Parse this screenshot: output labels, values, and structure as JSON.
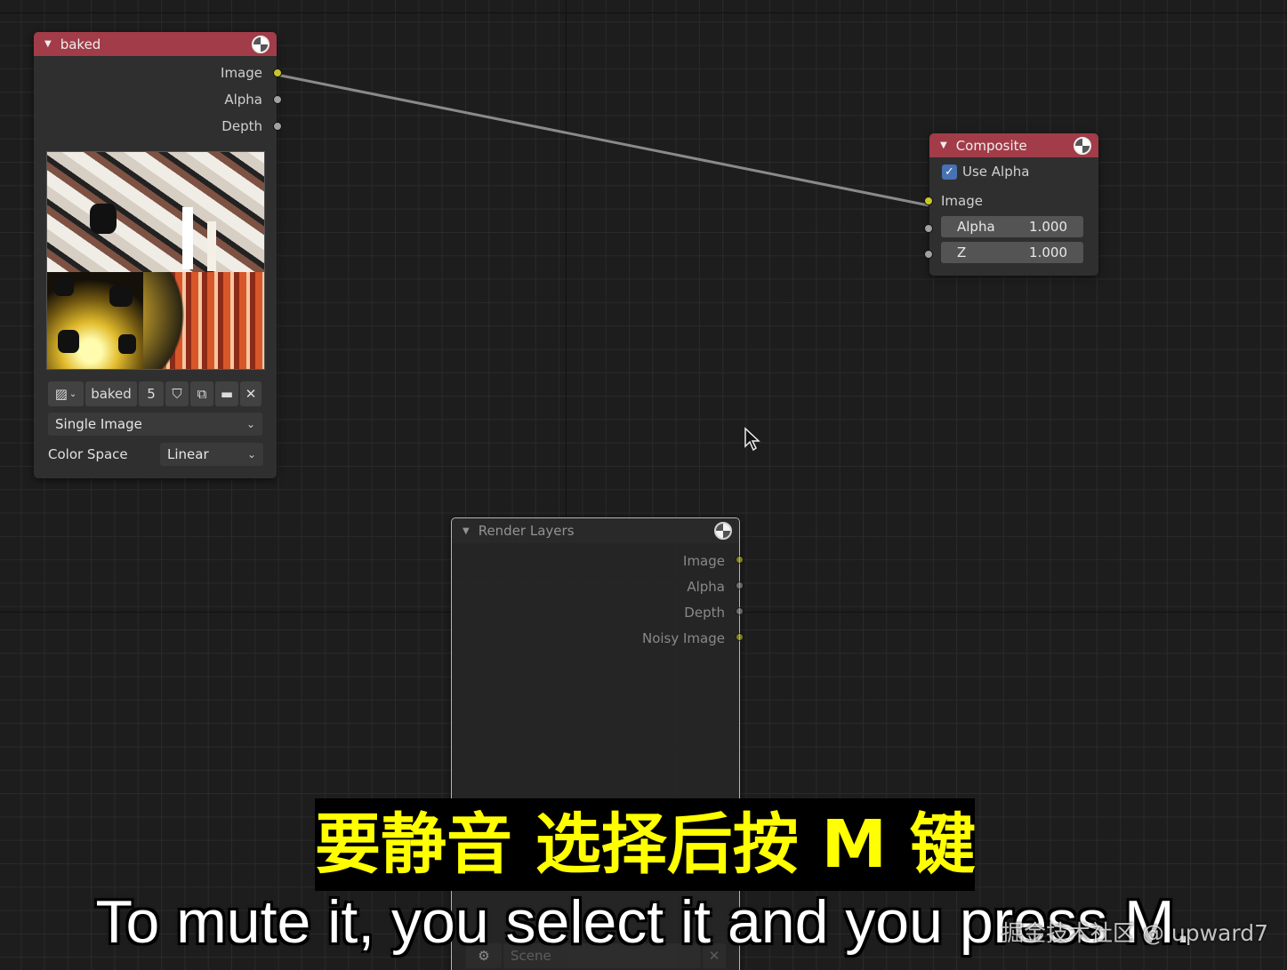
{
  "nodes": {
    "baked": {
      "title": "baked",
      "outputs": [
        "Image",
        "Alpha",
        "Depth"
      ],
      "image_name": "baked",
      "user_count": "5",
      "source": "Single Image",
      "color_space_label": "Color Space",
      "color_space_value": "Linear",
      "header_color": "#a23c48"
    },
    "composite": {
      "title": "Composite",
      "use_alpha_label": "Use Alpha",
      "use_alpha_checked": true,
      "image_input_label": "Image",
      "fields": [
        {
          "label": "Alpha",
          "value": "1.000"
        },
        {
          "label": "Z",
          "value": "1.000"
        }
      ],
      "header_color": "#a23c48"
    },
    "render_layers": {
      "title": "Render Layers",
      "outputs": [
        "Image",
        "Alpha",
        "Depth",
        "Noisy Image"
      ],
      "scene_label": "Scene",
      "muted": true
    }
  },
  "subtitles": {
    "chinese": "要静音 选择后按 M 键",
    "english": "To mute it, you select it and you press M."
  },
  "watermark": "掘金技术社区 @ upward7",
  "colors": {
    "socket_yellow": "#c7c729",
    "socket_gray": "#a1a1a1",
    "link": "#8a8a8a",
    "checkbox_blue": "#4772b3"
  }
}
